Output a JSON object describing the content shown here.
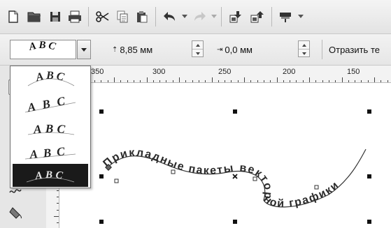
{
  "toolbar": {
    "icons": [
      "new-document-icon",
      "open-icon",
      "save-icon",
      "print-icon",
      "cut-icon",
      "copy-icon",
      "paste-icon",
      "undo-icon",
      "redo-icon",
      "import-icon",
      "export-icon",
      "publish-icon"
    ]
  },
  "property_bar": {
    "text_style_preview": "ABC",
    "distance_value": "8,85 мм",
    "offset_value": "0,0 мм",
    "reflect_label": "Отразить те"
  },
  "style_options": [
    {
      "label": "ABC",
      "selected": false
    },
    {
      "label": "ABC",
      "selected": false
    },
    {
      "label": "ABC",
      "selected": false
    },
    {
      "label": "ABC",
      "selected": false
    },
    {
      "label": "ABC",
      "selected": true
    }
  ],
  "ruler": {
    "labels": [
      "350",
      "300",
      "250",
      "200",
      "150"
    ]
  },
  "canvas": {
    "path_text": "Прикладные пакеты векторной графики"
  }
}
